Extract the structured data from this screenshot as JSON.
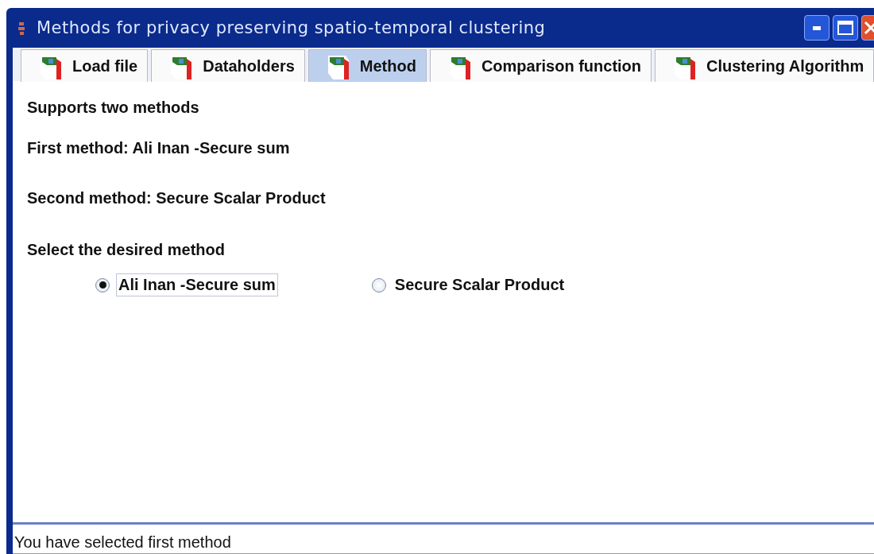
{
  "window": {
    "title": "Methods for privacy preserving spatio-temporal clustering"
  },
  "tabs": [
    {
      "label": "Load file",
      "selected": false
    },
    {
      "label": "Dataholders",
      "selected": false
    },
    {
      "label": "Method",
      "selected": true
    },
    {
      "label": "Comparison function",
      "selected": false
    },
    {
      "label": "Clustering Algorithm",
      "selected": false
    }
  ],
  "content": {
    "lines": [
      "Supports two methods",
      "First method: Ali Inan -Secure sum",
      "Second method: Secure Scalar Product",
      "Select the desired method"
    ],
    "options": [
      {
        "label": "Ali Inan -Secure sum",
        "selected": true
      },
      {
        "label": "Secure Scalar Product",
        "selected": false
      }
    ]
  },
  "status_bar": "You have selected first method"
}
